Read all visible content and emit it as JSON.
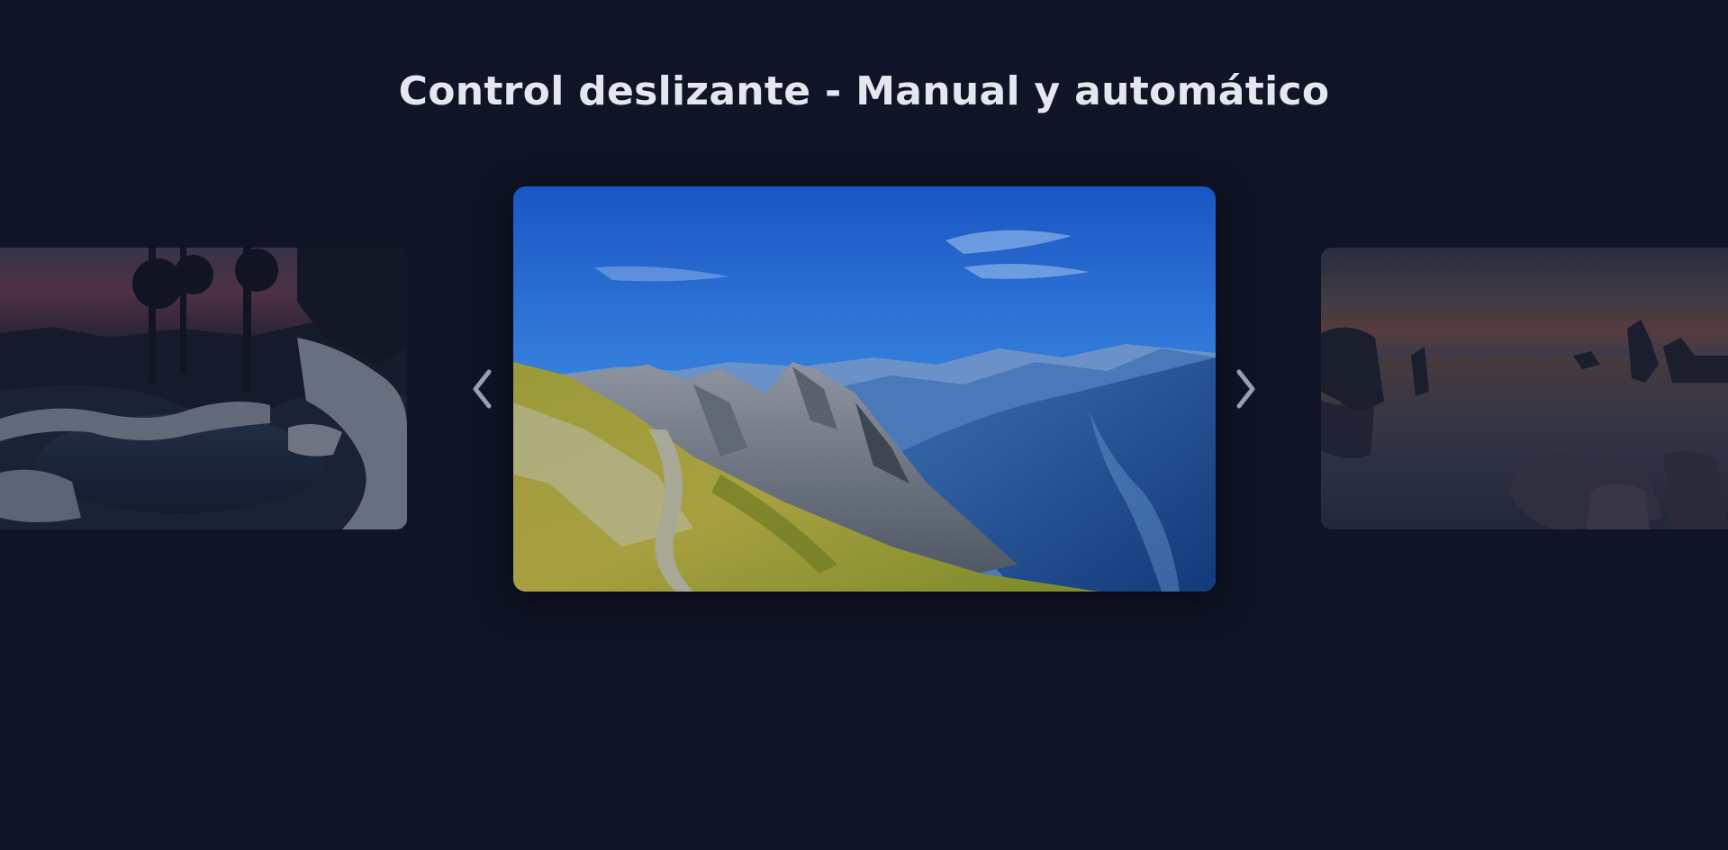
{
  "page": {
    "title": "Control deslizante - Manual y automático"
  },
  "slider": {
    "prev_arrow_icon": "chevron-left-icon",
    "next_arrow_icon": "chevron-right-icon",
    "slides": [
      {
        "subject": "frozen-waterfall-forest-sunset"
      },
      {
        "subject": "alpine-mountain-ridge-blue-sky"
      },
      {
        "subject": "lake-rock-towers-dusk"
      }
    ]
  },
  "colors": {
    "background": "#0f1426",
    "title": "#e4e6f0",
    "arrow": "#9aa0b4"
  }
}
